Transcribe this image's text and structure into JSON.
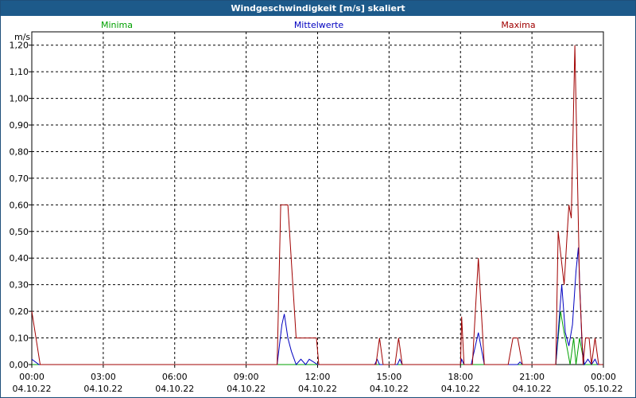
{
  "window": {
    "title": "Windgeschwindigkeit [m/s] skaliert"
  },
  "colors": {
    "minima": "#00a000",
    "mittel": "#0000c0",
    "maxima": "#a00000",
    "titlebar": "#1d5a8a"
  },
  "chart_data": {
    "type": "line",
    "title": "Windgeschwindigkeit [m/s] skaliert",
    "ylabel": "m/s",
    "xlabel": "",
    "ylim": [
      0,
      1.25
    ],
    "xlim_hours": [
      0,
      24
    ],
    "grid": true,
    "legend_placement": "top",
    "y_ticks": [
      "0,00",
      "0,10",
      "0,20",
      "0,30",
      "0,40",
      "0,50",
      "0,60",
      "0,70",
      "0,80",
      "0,90",
      "1,00",
      "1,10",
      "1,20"
    ],
    "x_ticks": [
      {
        "time": "00:00",
        "date": "04.10.22"
      },
      {
        "time": "03:00",
        "date": "04.10.22"
      },
      {
        "time": "06:00",
        "date": "04.10.22"
      },
      {
        "time": "09:00",
        "date": "04.10.22"
      },
      {
        "time": "12:00",
        "date": "04.10.22"
      },
      {
        "time": "15:00",
        "date": "04.10.22"
      },
      {
        "time": "18:00",
        "date": "04.10.22"
      },
      {
        "time": "21:00",
        "date": "04.10.22"
      },
      {
        "time": "00:00",
        "date": "05.10.22"
      }
    ],
    "series": [
      {
        "name": "Minima",
        "color": "#00a000",
        "points": [
          [
            0,
            0
          ],
          [
            10.5,
            0
          ],
          [
            22.0,
            0
          ],
          [
            22.1,
            0.1
          ],
          [
            22.2,
            0.2
          ],
          [
            22.35,
            0.12
          ],
          [
            22.5,
            0.05
          ],
          [
            22.6,
            0
          ],
          [
            22.75,
            0.1
          ],
          [
            22.85,
            0
          ],
          [
            23.0,
            0.1
          ],
          [
            23.1,
            0.05
          ],
          [
            23.2,
            0
          ],
          [
            24,
            0
          ]
        ]
      },
      {
        "name": "Mittelwerte",
        "color": "#0000c0",
        "points": [
          [
            0,
            0.02
          ],
          [
            0.3,
            0
          ],
          [
            10.3,
            0
          ],
          [
            10.5,
            0.15
          ],
          [
            10.6,
            0.19
          ],
          [
            10.75,
            0.1
          ],
          [
            10.9,
            0.05
          ],
          [
            11.1,
            0
          ],
          [
            11.3,
            0.02
          ],
          [
            11.5,
            0
          ],
          [
            11.65,
            0.02
          ],
          [
            12.0,
            0
          ],
          [
            14.4,
            0
          ],
          [
            14.5,
            0.02
          ],
          [
            14.6,
            0
          ],
          [
            15.35,
            0
          ],
          [
            15.45,
            0.02
          ],
          [
            15.55,
            0
          ],
          [
            18.0,
            0
          ],
          [
            18.05,
            0.02
          ],
          [
            18.15,
            0
          ],
          [
            18.45,
            0
          ],
          [
            18.75,
            0.12
          ],
          [
            19.0,
            0
          ],
          [
            20.4,
            0
          ],
          [
            20.5,
            0.01
          ],
          [
            20.6,
            0
          ],
          [
            22.0,
            0
          ],
          [
            22.25,
            0.3
          ],
          [
            22.4,
            0.12
          ],
          [
            22.55,
            0.07
          ],
          [
            22.7,
            0.15
          ],
          [
            22.85,
            0.35
          ],
          [
            22.95,
            0.44
          ],
          [
            23.1,
            0.08
          ],
          [
            23.2,
            0
          ],
          [
            23.35,
            0.02
          ],
          [
            23.5,
            0
          ],
          [
            23.65,
            0.02
          ],
          [
            23.75,
            0
          ],
          [
            24,
            0
          ]
        ]
      },
      {
        "name": "Maxima",
        "color": "#a00000",
        "points": [
          [
            0,
            0.2
          ],
          [
            0.35,
            0
          ],
          [
            10.3,
            0
          ],
          [
            10.45,
            0.6
          ],
          [
            10.75,
            0.6
          ],
          [
            11.1,
            0.1
          ],
          [
            11.95,
            0.1
          ],
          [
            12.05,
            0
          ],
          [
            14.45,
            0
          ],
          [
            14.6,
            0.1
          ],
          [
            14.75,
            0
          ],
          [
            15.25,
            0
          ],
          [
            15.4,
            0.1
          ],
          [
            15.55,
            0
          ],
          [
            18.0,
            0
          ],
          [
            18.05,
            0.18
          ],
          [
            18.15,
            0
          ],
          [
            18.5,
            0
          ],
          [
            18.75,
            0.4
          ],
          [
            19.0,
            0
          ],
          [
            20.0,
            0
          ],
          [
            20.2,
            0.1
          ],
          [
            20.4,
            0.1
          ],
          [
            20.6,
            0
          ],
          [
            22.0,
            0
          ],
          [
            22.1,
            0.5
          ],
          [
            22.35,
            0.3
          ],
          [
            22.55,
            0.6
          ],
          [
            22.65,
            0.55
          ],
          [
            22.8,
            1.2
          ],
          [
            23.0,
            0.3
          ],
          [
            23.15,
            0
          ],
          [
            23.25,
            0.1
          ],
          [
            23.4,
            0.1
          ],
          [
            23.5,
            0
          ],
          [
            23.65,
            0.1
          ],
          [
            23.8,
            0
          ],
          [
            24,
            0
          ]
        ]
      }
    ]
  }
}
